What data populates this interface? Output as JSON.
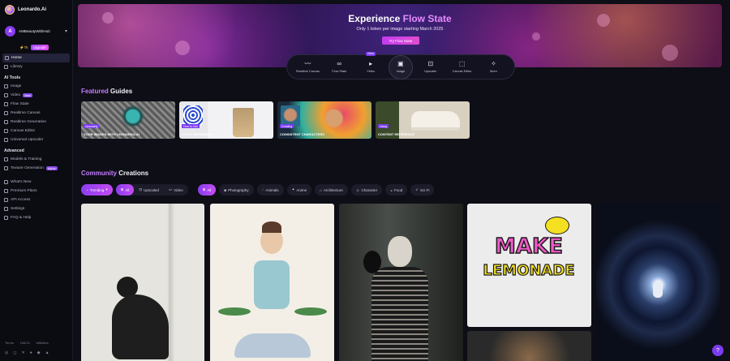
{
  "brand": {
    "name": "Leonardo.Ai"
  },
  "user": {
    "avatar_letter": "A",
    "name": "AMBeautyWithHub",
    "tokens": "Tk",
    "upgrade": "Upgrade"
  },
  "nav": {
    "home": "Home",
    "library": "Library",
    "ai_tools_heading": "AI Tools",
    "image": "Image",
    "video": "Video",
    "video_badge": "New",
    "flow_state": "Flow State",
    "realtime_canvas": "Realtime Canvas",
    "realtime_generation": "Realtime Generation",
    "canvas_editor": "Canvas Editor",
    "universal_upscaler": "Universal Upscaler",
    "advanced_heading": "Advanced",
    "models_training": "Models & Training",
    "texture_generation": "Texture Generation",
    "texture_badge": "Alpha",
    "whats_new": "What's New",
    "premium_plans": "Premium Plans",
    "api_access": "API Access",
    "settings": "Settings",
    "faq_help": "FAQ & Help"
  },
  "footer": {
    "terms": "Terms",
    "dmca": "DMCA",
    "affiliates": "Affiliates"
  },
  "hero": {
    "title_prefix": "Experience ",
    "title_highlight": "Flow State",
    "subtitle": "Only 1 token per image starting March 2025",
    "button": "Try Flow State"
  },
  "tools": [
    {
      "label": "Realtime Canvas",
      "icon": "realtime-icon"
    },
    {
      "label": "Flow State",
      "icon": "infinity-icon"
    },
    {
      "label": "Video",
      "icon": "video-icon",
      "badge": "New"
    },
    {
      "label": "Image",
      "icon": "image-icon"
    },
    {
      "label": "Upscaler",
      "icon": "upscaler-icon"
    },
    {
      "label": "Canvas Editor",
      "icon": "canvas-icon"
    },
    {
      "label": "More",
      "icon": "sparkles-icon"
    }
  ],
  "guides_section": {
    "accent": "Featured",
    "title": " Guides"
  },
  "guides": [
    {
      "tag": "Upscaling",
      "caption": "YOUR IMAGES WITH LEONARDO.AI"
    },
    {
      "tag": "How to Use",
      "caption": "STYLE REFERENCE"
    },
    {
      "tag": "Creating",
      "caption": "CONSISTENT CHARACTERS"
    },
    {
      "tag": "Using",
      "caption": "CONTENT REFERENCE"
    }
  ],
  "community_section": {
    "accent": "Community",
    "title": " Creations"
  },
  "filters": {
    "trending": "Trending",
    "type_all": "All",
    "upscaled": "Upscaled",
    "video": "Video",
    "cat_all": "All",
    "categories": [
      "Photography",
      "Animals",
      "Anime",
      "Architecture",
      "Character",
      "Food",
      "Sci-Fi"
    ]
  },
  "gallery_texts": {
    "make": "MAKE",
    "lemonade": "LEMONADE"
  },
  "colors": {
    "accent": "#8a3cf0",
    "accent2": "#c44cf0",
    "bg": "#0e0e16"
  }
}
